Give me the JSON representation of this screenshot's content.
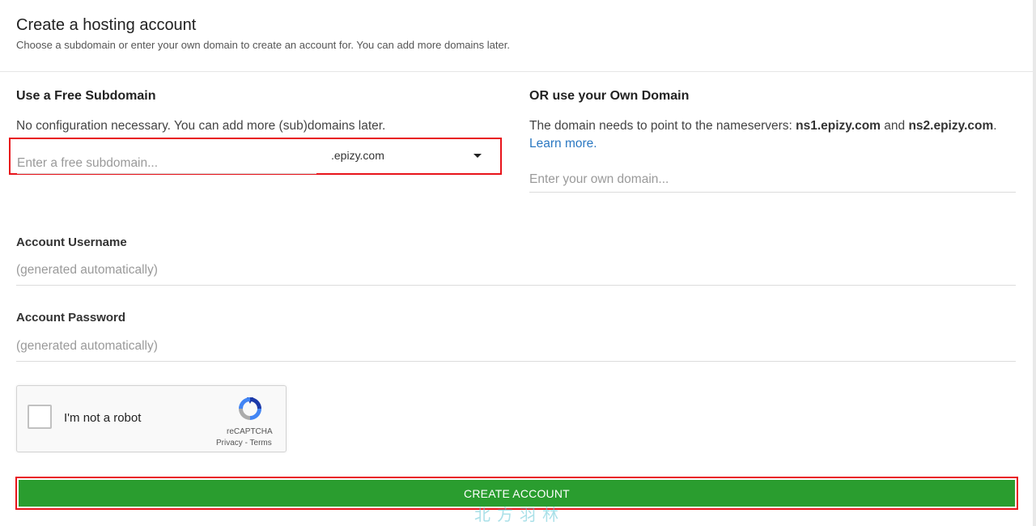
{
  "header": {
    "title": "Create a hosting account",
    "subtitle": "Choose a subdomain or enter your own domain to create an account for. You can add more domains later."
  },
  "free_subdomain": {
    "heading": "Use a Free Subdomain",
    "help": "No configuration necessary. You can add more (sub)domains later.",
    "input_placeholder": "Enter a free subdomain...",
    "input_value": "",
    "domain_selected": ".epizy.com"
  },
  "own_domain": {
    "heading": "OR use your Own Domain",
    "help_prefix": "The domain needs to point to the nameservers: ",
    "ns1": "ns1.epizy.com",
    "and_text": " and ",
    "ns2": "ns2.epizy.com",
    "period": ".",
    "learn_more": "Learn more.",
    "input_placeholder": "Enter your own domain...",
    "input_value": ""
  },
  "username": {
    "label": "Account Username",
    "placeholder": "(generated automatically)"
  },
  "password": {
    "label": "Account Password",
    "placeholder": "(generated automatically)"
  },
  "captcha": {
    "label": "I'm not a robot",
    "brand": "reCAPTCHA",
    "privacy": "Privacy",
    "sep": " - ",
    "terms": "Terms"
  },
  "submit": {
    "label": "CREATE ACCOUNT"
  },
  "watermark": "北方羽林",
  "colors": {
    "button_green": "#2a9d2f",
    "highlight_red": "#e8131a",
    "link_blue": "#2b78c2"
  }
}
